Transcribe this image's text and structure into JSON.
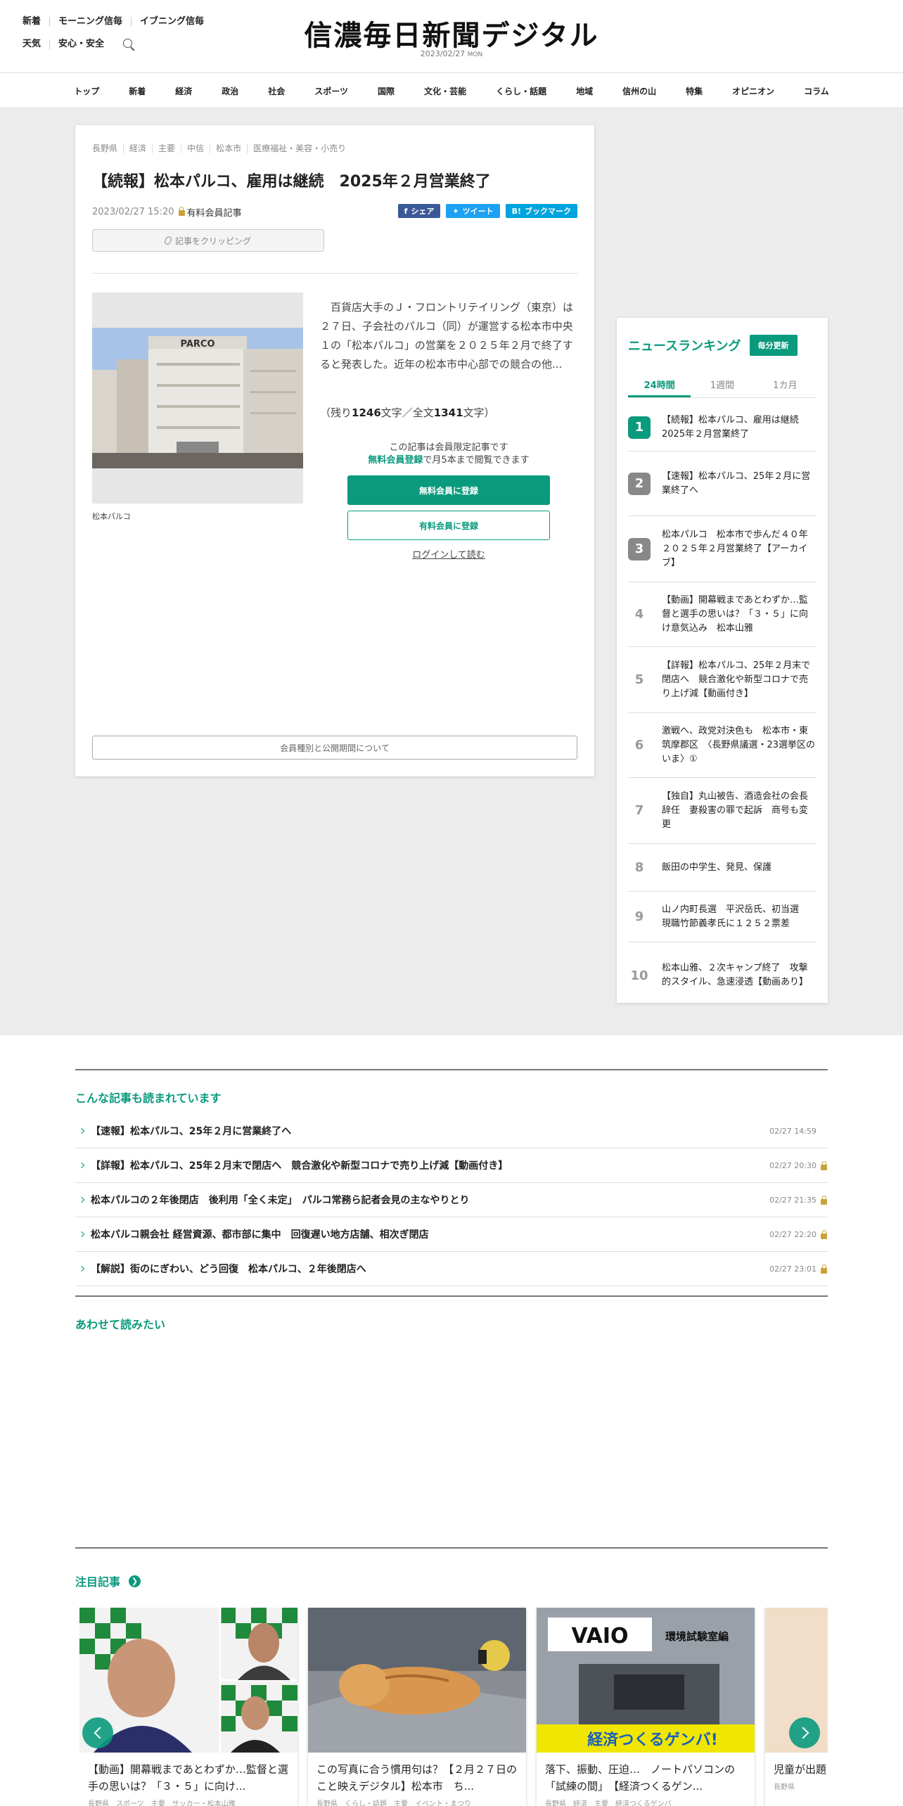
{
  "header": {
    "links_row1": [
      "新着",
      "モーニング信毎",
      "イブニング信毎"
    ],
    "links_row2": [
      "天気",
      "安心・安全"
    ],
    "logo": "信濃毎日新聞デジタル",
    "date": "2023/02/27",
    "weekday": "MON"
  },
  "nav": [
    "トップ",
    "新着",
    "経済",
    "政治",
    "社会",
    "スポーツ",
    "国際",
    "文化・芸能",
    "くらし・話題",
    "地域",
    "信州の山",
    "特集",
    "オピニオン",
    "コラム"
  ],
  "article": {
    "tags": [
      "長野県",
      "経済",
      "主要",
      "中信",
      "松本市",
      "医療福祉・美容・小売り"
    ],
    "title": "【続報】松本パルコ、雇用は継続　2025年２月営業終了",
    "datetime": "2023/02/27 15:20",
    "paid_label": "有料会員記事",
    "share": {
      "facebook": "シェア",
      "twitter": "ツイート",
      "hatena": "ブックマーク"
    },
    "clip_label": "記事をクリッピング",
    "photo_caption": "松本パルコ",
    "photo_sign": "PARCO",
    "lead": "百貨店大手のＪ・フロントリテイリング（東京）は２７日、子会社のパルコ（同）が運営する松本市中央１の「松本パルコ」の営業を２０２５年２月で終了すると発表した。近年の松本市中心部での競合の他...",
    "remain_prefix": "（残り",
    "remain_chars": "1246",
    "remain_mid": "文字／全文",
    "total_chars": "1341",
    "remain_suffix": "文字）",
    "paywall_line1": "この記事は会員限定記事です",
    "paywall_green": "無料会員登録",
    "paywall_line2": "で月5本まで閲覧できます",
    "btn_free": "無料会員に登録",
    "btn_paid": "有料会員に登録",
    "login": "ログインして読む",
    "member_types": "会員種別と公開期間について"
  },
  "ranking": {
    "title": "ニュースランキング",
    "badge": "毎分更新",
    "tabs": [
      "24時間",
      "1週間",
      "1カ月"
    ],
    "items": [
      {
        "rank": "1",
        "text": "【続報】松本パルコ、雇用は継続　2025年２月営業終了"
      },
      {
        "rank": "2",
        "text": "【速報】松本パルコ、25年２月に営業終了へ"
      },
      {
        "rank": "3",
        "text": "松本パルコ　松本市で歩んだ４０年　２０２５年２月営業終了【アーカイブ】"
      },
      {
        "rank": "4",
        "text": "【動画】開幕戦まであとわずか…監督と選手の思いは？「３・５」に向け意気込み　松本山雅"
      },
      {
        "rank": "5",
        "text": "【詳報】松本パルコ、25年２月末で閉店へ　競合激化や新型コロナで売り上げ減【動画付き】"
      },
      {
        "rank": "6",
        "text": "激戦へ、政党対決色も　松本市・東筑摩郡区　〈長野県議選・23選挙区のいま〉①"
      },
      {
        "rank": "7",
        "text": "【独自】丸山被告、酒造会社の会長辞任　妻殺害の罪で起訴　商号も変更"
      },
      {
        "rank": "8",
        "text": "飯田の中学生、発見、保護"
      },
      {
        "rank": "9",
        "text": "山ノ内町長選　平沢岳氏、初当選　現職竹節義孝氏に１２５２票差"
      },
      {
        "rank": "10",
        "text": "松本山雅、２次キャンプ終了　攻撃的スタイル、急速浸透【動画あり】"
      }
    ]
  },
  "related": {
    "title": "こんな記事も読まれています",
    "items": [
      {
        "text": "【速報】松本パルコ、25年２月に営業終了へ",
        "time": "02/27 14:59",
        "locked": false
      },
      {
        "text": "【詳報】松本パルコ、25年２月末で閉店へ　競合激化や新型コロナで売り上げ減【動画付き】",
        "time": "02/27 20:30",
        "locked": true
      },
      {
        "text": "松本パルコの２年後閉店　後利用「全く未定」　パルコ常務ら記者会見の主なやりとり",
        "time": "02/27 21:35",
        "locked": true
      },
      {
        "text": "松本パルコ親会社 経営資源、都市部に集中　回復遅い地方店舗、相次ぎ閉店",
        "time": "02/27 22:20",
        "locked": true
      },
      {
        "text": "【解説】街のにぎわい、どう回復　松本パルコ、２年後閉店へ",
        "time": "02/27 23:01",
        "locked": true
      }
    ]
  },
  "also_read": {
    "title": "あわせて読みたい"
  },
  "featured": {
    "title": "注目記事",
    "cards": [
      {
        "text": "【動画】開幕戦まであとわずか…監督と選手の思いは？「３・５」に向け...",
        "tags": "長野県　スポーツ　主要　サッカー・松本山雅"
      },
      {
        "text": "この写真に合う慣用句は？【２月２７日のこと映えデジタル】松本市　ち...",
        "tags": "長野県　くらし・話題　主要　イベント・まつり"
      },
      {
        "text": "落下、振動、圧迫…　ノートパソコンの「試練の間」　【経済つくるゲン...",
        "tags": "長野県　経済　主要　経済つくるゲンバ"
      },
      {
        "text": "児童が出題　裏は？",
        "tags": "長野県"
      }
    ],
    "vaio_logo": "VAIO",
    "vaio_label": "環境試験室編",
    "genba_label": "経済つくるゲンバ!"
  }
}
